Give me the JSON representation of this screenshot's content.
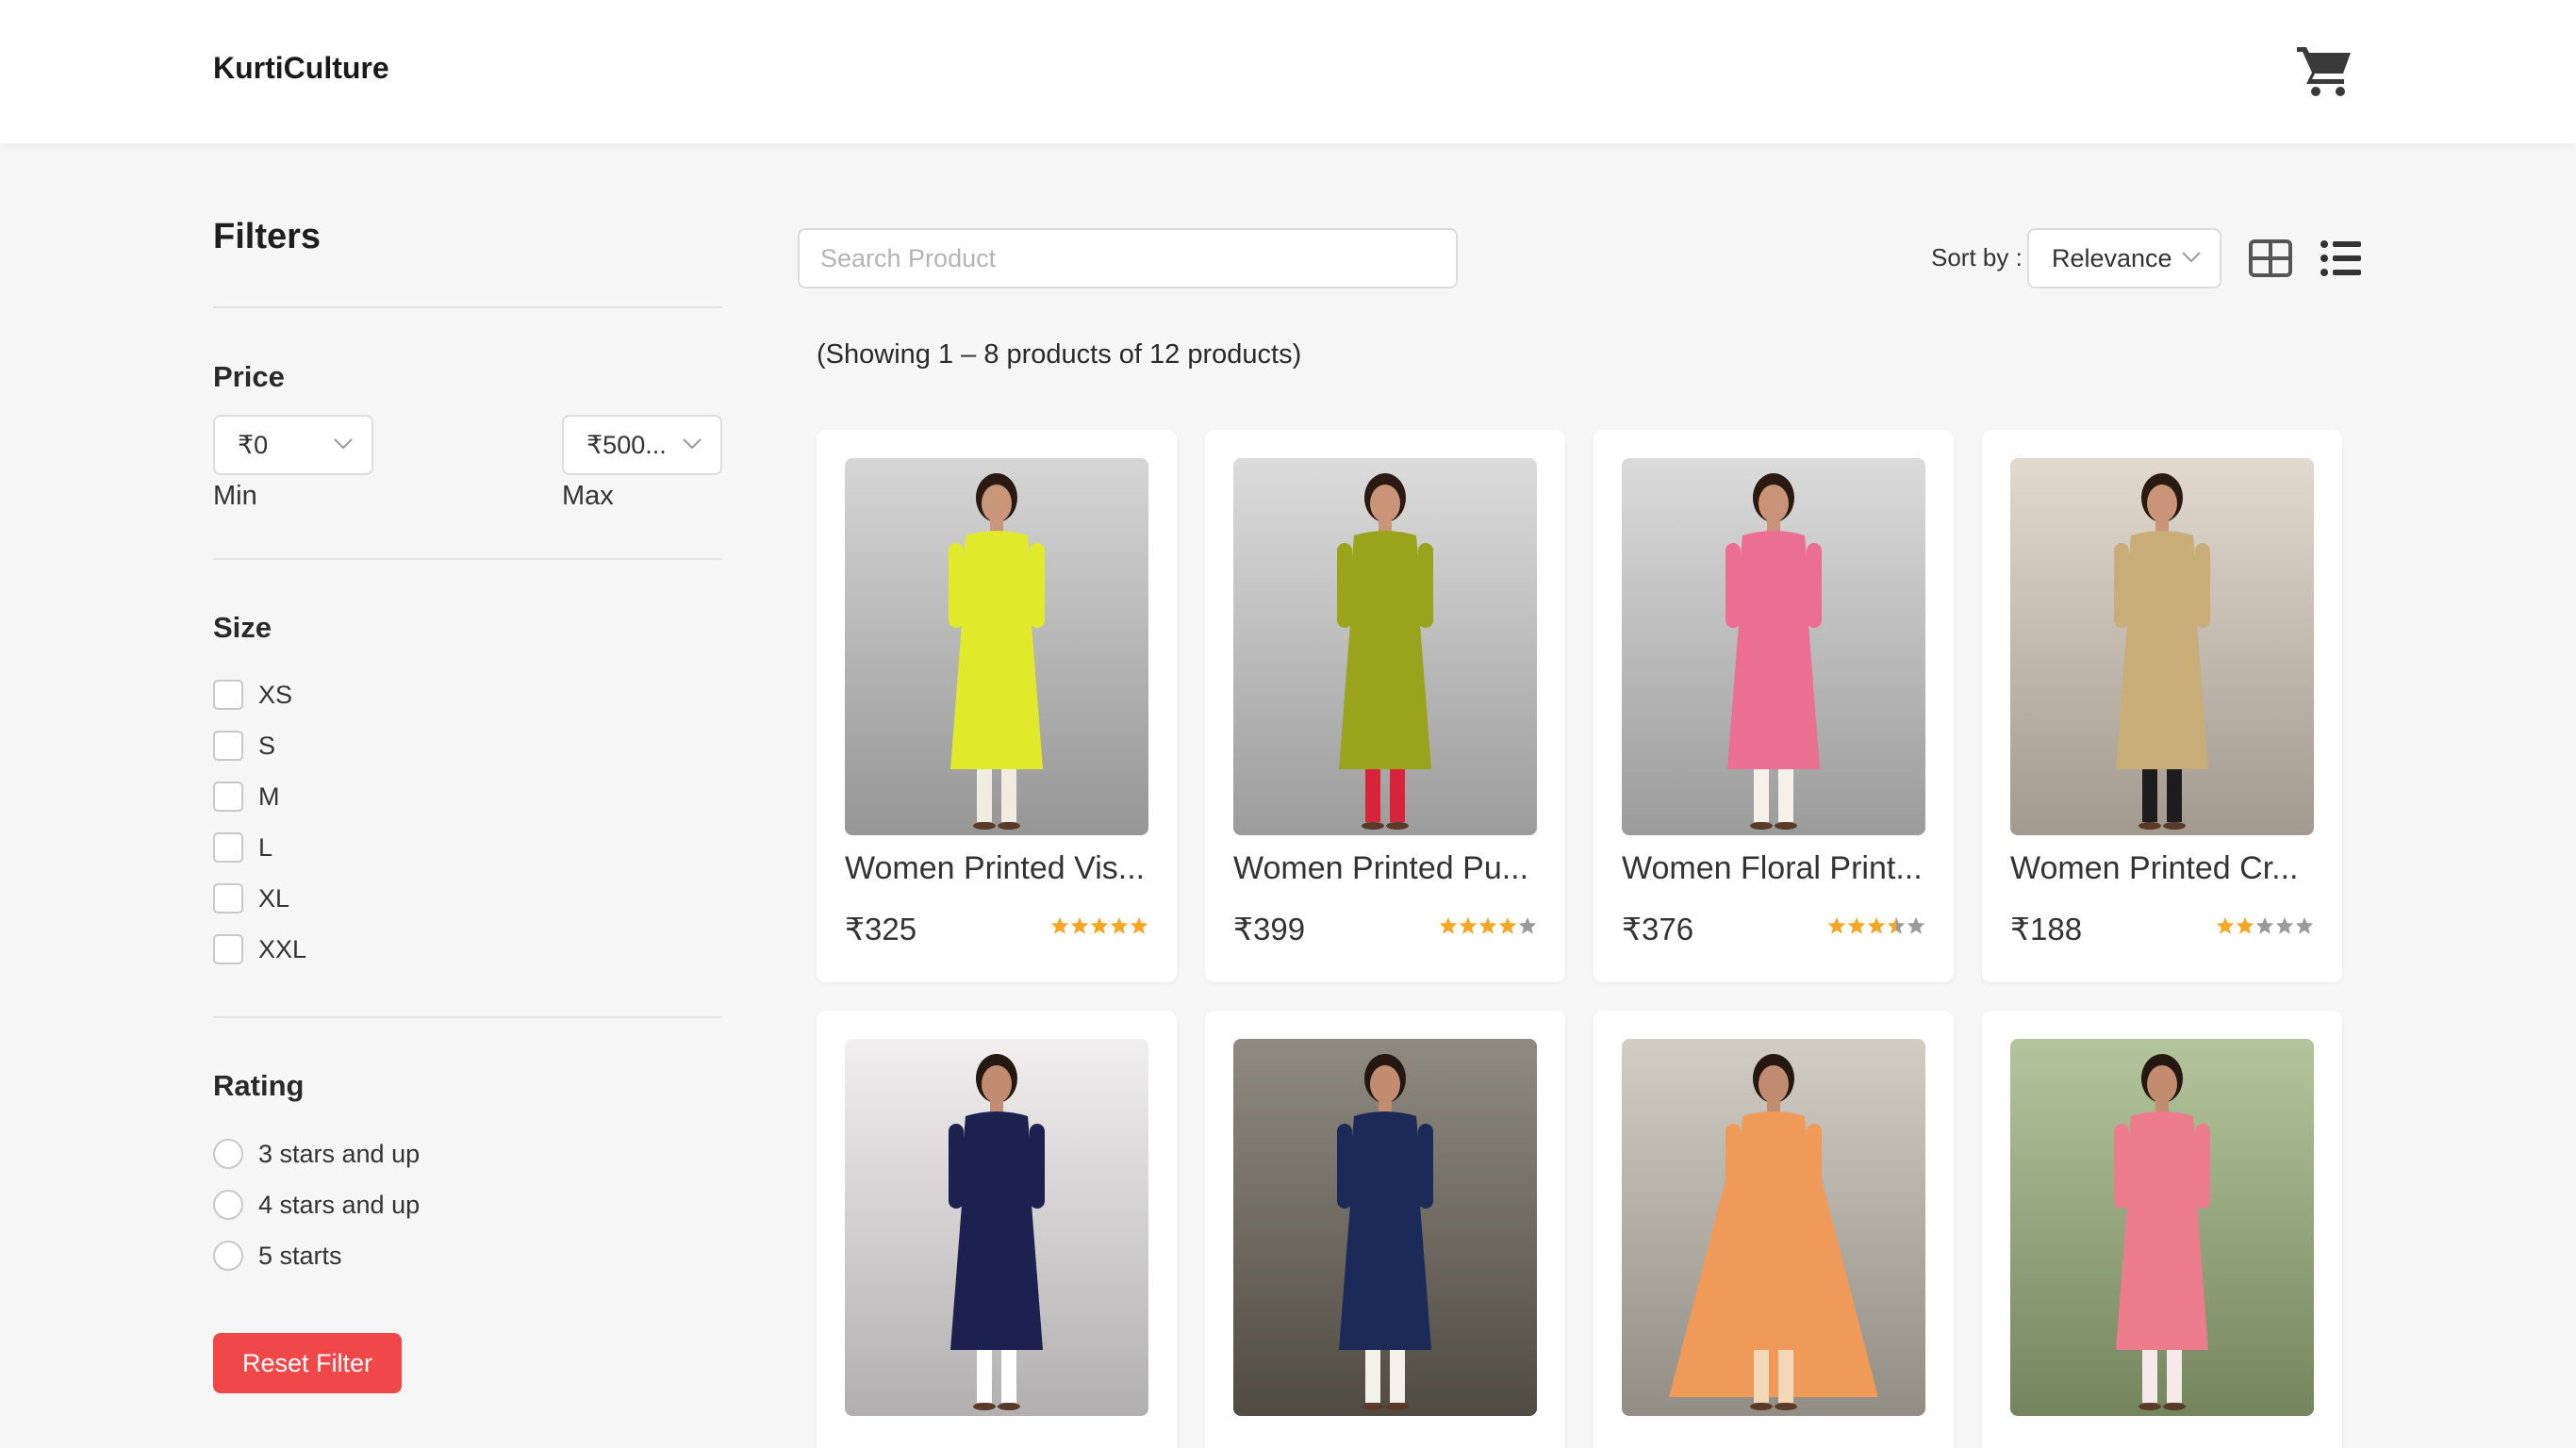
{
  "header": {
    "logo": "KurtiCulture",
    "cart_icon": "cart-icon"
  },
  "filters": {
    "title": "Filters",
    "price": {
      "title": "Price",
      "min_value": "₹0",
      "max_value": "₹500...",
      "min_label": "Min",
      "max_label": "Max"
    },
    "size": {
      "title": "Size",
      "options": [
        "XS",
        "S",
        "M",
        "L",
        "XL",
        "XXL"
      ]
    },
    "rating": {
      "title": "Rating",
      "options": [
        "3 stars and up",
        "4 stars and up",
        "5 starts"
      ]
    },
    "reset_label": "Reset Filter"
  },
  "toolbar": {
    "search_placeholder": "Search Product",
    "sort_label": "Sort by :",
    "sort_value": "Relevance",
    "grid_icon": "grid-view-icon",
    "list_icon": "list-view-icon"
  },
  "results_text": "(Showing 1 – 8 products of 12 products)",
  "colors": {
    "accent": "#f04848",
    "star": "#f5a623",
    "star_empty": "#9a9a9a"
  },
  "products": [
    {
      "name": "Women Printed Vis...",
      "price": "₹325",
      "rating": 5,
      "image": "yellow printed kurta"
    },
    {
      "name": "Women Printed Pu...",
      "price": "₹399",
      "rating": 4,
      "image": "olive green printed kurta"
    },
    {
      "name": "Women Floral Print...",
      "price": "₹376",
      "rating": 3.5,
      "image": "pink floral kurta"
    },
    {
      "name": "Women Printed Cr...",
      "price": "₹188",
      "rating": 2,
      "image": "beige paisley kurta"
    },
    {
      "name": "",
      "price": "",
      "rating": 0,
      "image": "navy printed kurta"
    },
    {
      "name": "",
      "price": "",
      "rating": 0,
      "image": "navy embroidered kurta"
    },
    {
      "name": "",
      "price": "",
      "rating": 0,
      "image": "orange ombre anarkali"
    },
    {
      "name": "",
      "price": "",
      "rating": 0,
      "image": "pink printed kurta"
    }
  ]
}
